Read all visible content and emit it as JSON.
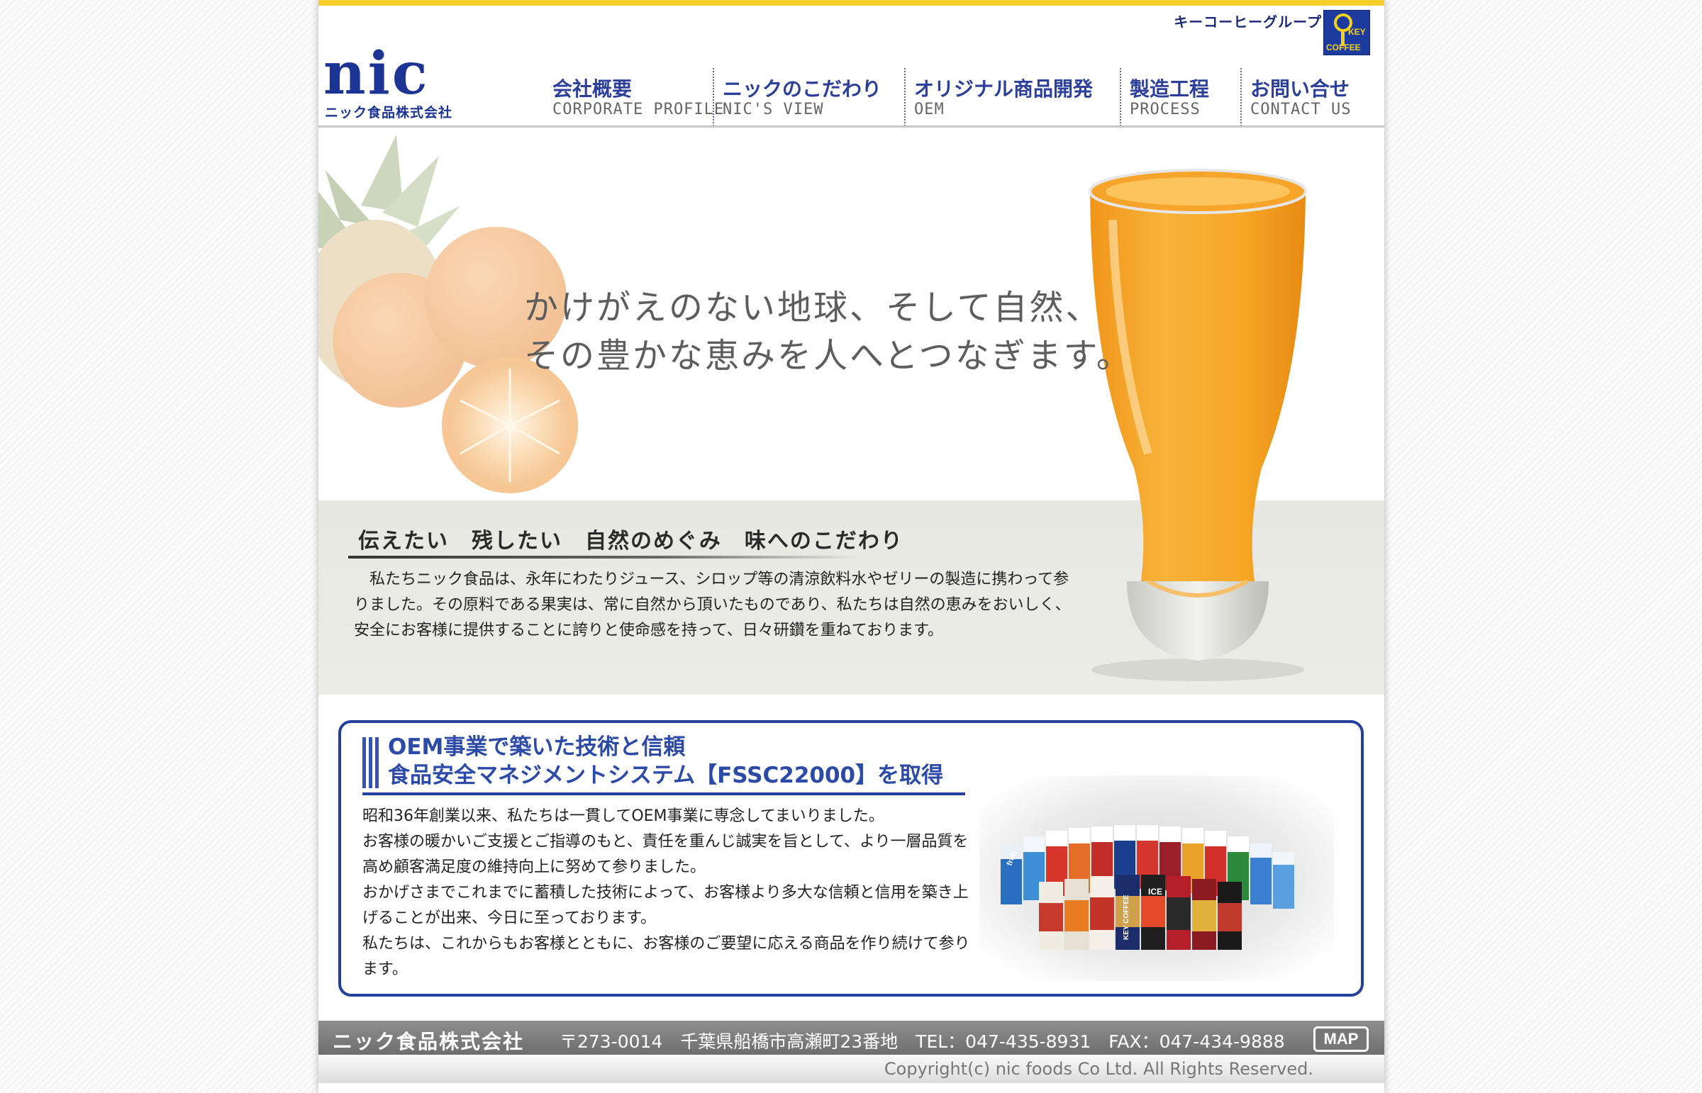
{
  "header": {
    "group_label": "キーコーヒーグループ",
    "key_logo": {
      "line1": "KEY",
      "line2": "COFFEE"
    },
    "logo": {
      "word": "nic",
      "company": "ニック食品株式会社"
    }
  },
  "nav": [
    {
      "jp": "会社概要",
      "en": "CORPORATE PROFILE"
    },
    {
      "jp": "ニックのこだわり",
      "en": "NIC'S VIEW"
    },
    {
      "jp": "オリジナル商品開発",
      "en": "OEM"
    },
    {
      "jp": "製造工程",
      "en": "PROCESS"
    },
    {
      "jp": "お問い合せ",
      "en": "CONTACT US"
    }
  ],
  "hero": {
    "tagline_line1": "かけがえのない地球、そして自然、",
    "tagline_line2": "その豊かな恵みを人へとつなぎます。",
    "subhead": "伝えたい　残したい　自然のめぐみ　味へのこだわり",
    "intro": "　私たちニック食品は、永年にわたりジュース、シロップ等の清涼飲料水やゼリーの製造に携わって参りました。その原料である果実は、常に自然から頂いたものであり、私たちは自然の恵みをおいしく、安全にお客様に提供することに誇りと使命感を持って、日々研鑽を重ねております。"
  },
  "oem": {
    "title_line1": "OEM事業で築いた技術と信頼",
    "title_line2": "食品安全マネジメントシステム【FSSC22000】を取得",
    "paragraphs": [
      "昭和36年創業以来、私たちは一貫してOEM事業に専念してまいりました。",
      "お客様の暖かいご支援とご指導のもと、責任を重んじ誠実を旨として、より一層品質を高め顧客満足度の維持向上に努めて参りました。",
      "おかげさまでこれまでに蓄積した技術によって、お客様より多大な信頼と信用を築き上げることが出来、今日に至っております。",
      "私たちは、これからもお客様とともに、お客様のご要望に応える商品を作り続けて参ります。"
    ],
    "product_labels": [
      "fruit",
      "KEY COFFEE",
      "ICE"
    ]
  },
  "footer": {
    "company": "ニック食品株式会社",
    "address": "〒273-0014　千葉県船橋市高瀬町23番地　TEL：047-435-8931　FAX：047-434-9888",
    "map_label": "MAP",
    "copyright": "Copyright(c) nic foods Co Ltd. All Rights Reserved."
  },
  "colors": {
    "brand_blue": "#23409a",
    "top_bar": "#f6cf2a",
    "juice_orange": "#f5a21c"
  }
}
